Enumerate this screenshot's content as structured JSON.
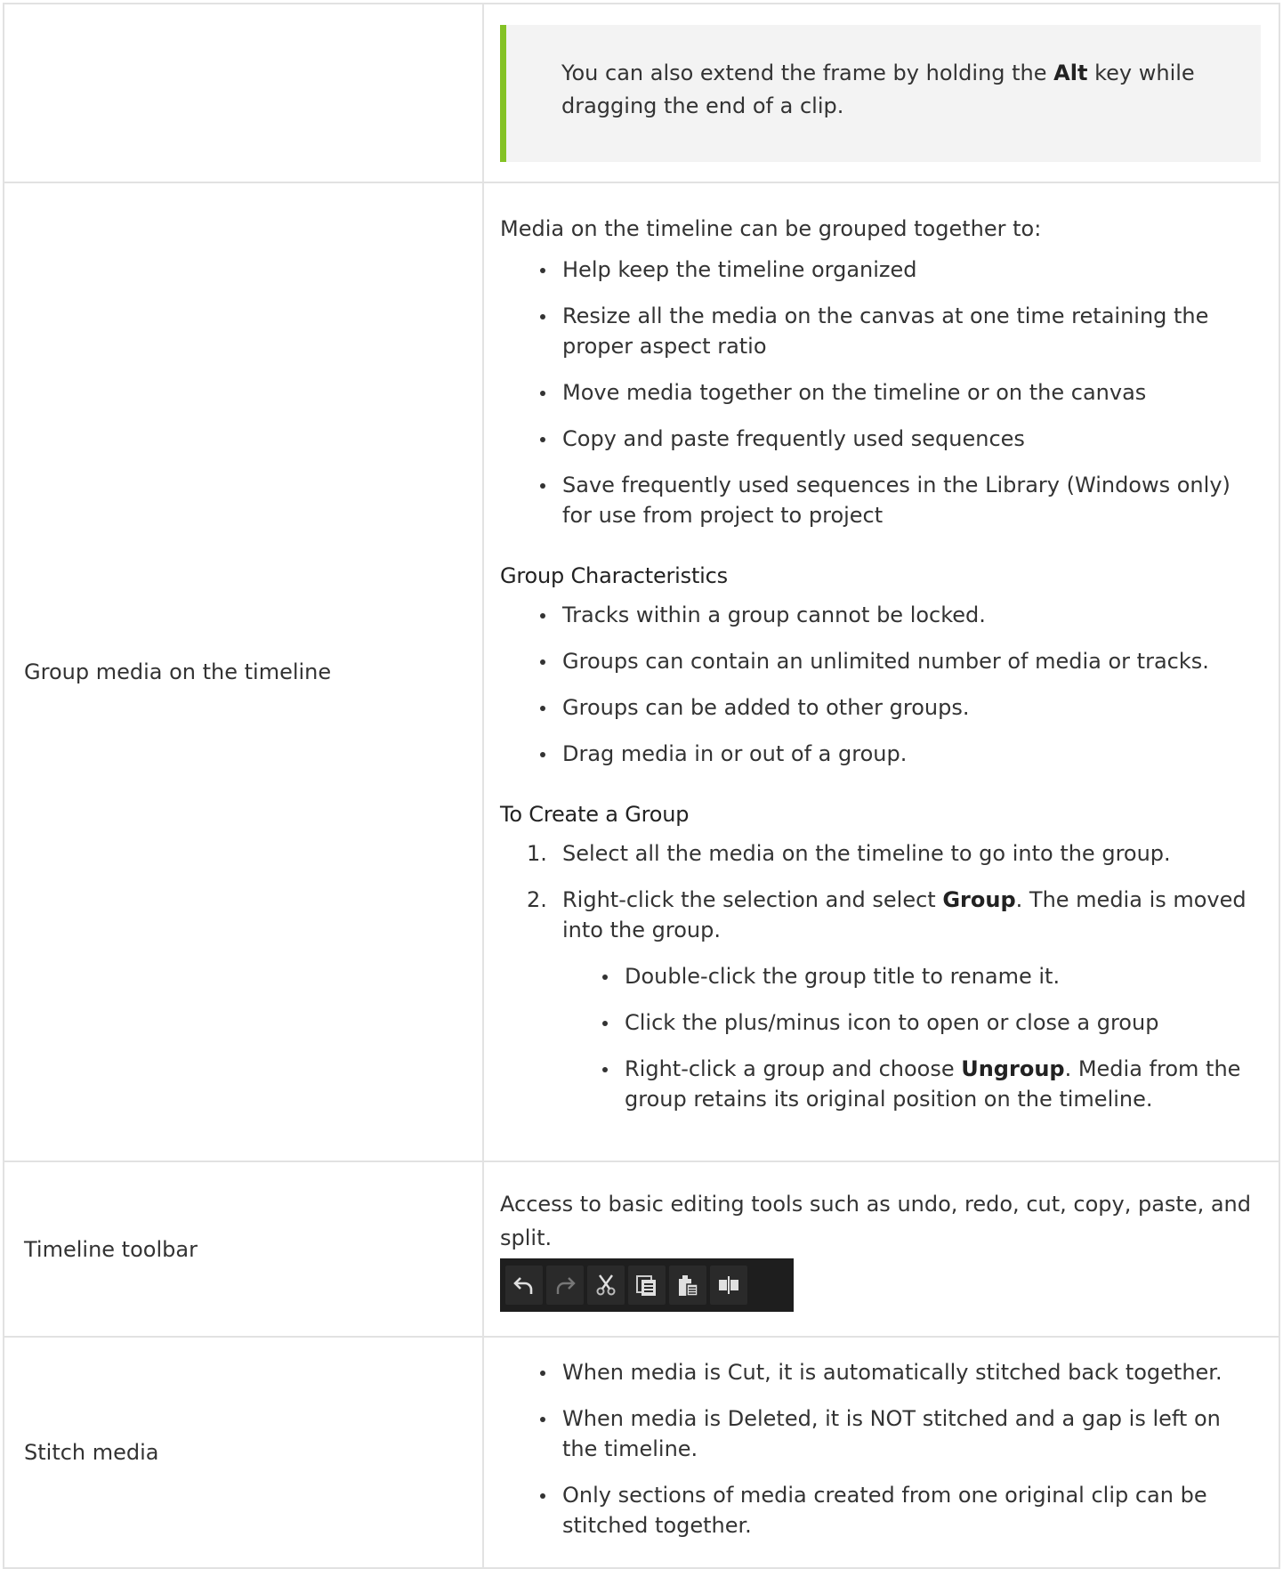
{
  "note": {
    "text_before": "You can also extend the frame by holding the ",
    "bold": "Alt",
    "text_after": " key while dragging the end of a clip."
  },
  "rows": {
    "group": {
      "label": "Group media on the timeline",
      "intro": "Media on the timeline can be grouped together to:",
      "bullets": [
        "Help keep the timeline organized",
        "Resize all the media on the canvas at one time retaining the proper aspect ratio",
        "Move media together on the timeline or on the canvas",
        "Copy and paste frequently used sequences",
        "Save frequently used sequences in the Library (Windows only) for use from project to project"
      ],
      "characteristics_heading": "Group Characteristics",
      "characteristics": [
        "Tracks within a group cannot be locked.",
        "Groups can contain an unlimited number of media or tracks.",
        "Groups can be added to other groups.",
        "Drag media in or out of a group."
      ],
      "create_heading": "To Create a Group",
      "steps": [
        {
          "num": "1.",
          "text": "Select all the media on the timeline to go into the group."
        },
        {
          "num": "2.",
          "text_before": "Right-click the selection and select ",
          "bold": "Group",
          "text_after": ". The media is moved into the group."
        }
      ],
      "sub_bullets": [
        {
          "text": "Double-click the group title to rename it."
        },
        {
          "text": "Click the plus/minus icon to open or close a group"
        },
        {
          "text_before": "Right-click a group and choose ",
          "bold": "Ungroup",
          "text_after": ". Media from the group retains its original position on the timeline."
        }
      ]
    },
    "toolbar": {
      "label": "Timeline toolbar",
      "description": "Access to basic editing tools such as undo, redo, cut, copy, paste, and split.",
      "icons": [
        "undo-icon",
        "redo-icon",
        "cut-icon",
        "copy-icon",
        "paste-icon",
        "split-icon"
      ],
      "bg_color": "#1e1e1e"
    },
    "stitch": {
      "label": "Stitch media",
      "bullets": [
        "When media is Cut, it is automatically stitched back together.",
        "When media is Deleted, it is NOT stitched and a gap is left on the timeline.",
        "Only sections of media created from one original clip can be stitched together."
      ]
    }
  },
  "colors": {
    "accent": "#84c225",
    "note_bg": "#f3f3f3",
    "border": "#e2e2e2"
  }
}
